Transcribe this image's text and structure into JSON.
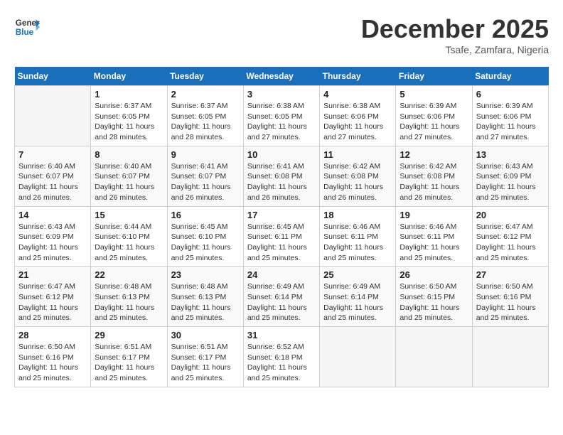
{
  "header": {
    "logo_line1": "General",
    "logo_line2": "Blue",
    "month": "December 2025",
    "location": "Tsafe, Zamfara, Nigeria"
  },
  "days_of_week": [
    "Sunday",
    "Monday",
    "Tuesday",
    "Wednesday",
    "Thursday",
    "Friday",
    "Saturday"
  ],
  "weeks": [
    [
      {
        "day": "",
        "empty": true
      },
      {
        "day": "1",
        "sunrise": "6:37 AM",
        "sunset": "6:05 PM",
        "daylight": "11 hours and 28 minutes."
      },
      {
        "day": "2",
        "sunrise": "6:37 AM",
        "sunset": "6:05 PM",
        "daylight": "11 hours and 28 minutes."
      },
      {
        "day": "3",
        "sunrise": "6:38 AM",
        "sunset": "6:05 PM",
        "daylight": "11 hours and 27 minutes."
      },
      {
        "day": "4",
        "sunrise": "6:38 AM",
        "sunset": "6:06 PM",
        "daylight": "11 hours and 27 minutes."
      },
      {
        "day": "5",
        "sunrise": "6:39 AM",
        "sunset": "6:06 PM",
        "daylight": "11 hours and 27 minutes."
      },
      {
        "day": "6",
        "sunrise": "6:39 AM",
        "sunset": "6:06 PM",
        "daylight": "11 hours and 27 minutes."
      }
    ],
    [
      {
        "day": "7",
        "sunrise": "6:40 AM",
        "sunset": "6:07 PM",
        "daylight": "11 hours and 26 minutes."
      },
      {
        "day": "8",
        "sunrise": "6:40 AM",
        "sunset": "6:07 PM",
        "daylight": "11 hours and 26 minutes."
      },
      {
        "day": "9",
        "sunrise": "6:41 AM",
        "sunset": "6:07 PM",
        "daylight": "11 hours and 26 minutes."
      },
      {
        "day": "10",
        "sunrise": "6:41 AM",
        "sunset": "6:08 PM",
        "daylight": "11 hours and 26 minutes."
      },
      {
        "day": "11",
        "sunrise": "6:42 AM",
        "sunset": "6:08 PM",
        "daylight": "11 hours and 26 minutes."
      },
      {
        "day": "12",
        "sunrise": "6:42 AM",
        "sunset": "6:08 PM",
        "daylight": "11 hours and 26 minutes."
      },
      {
        "day": "13",
        "sunrise": "6:43 AM",
        "sunset": "6:09 PM",
        "daylight": "11 hours and 25 minutes."
      }
    ],
    [
      {
        "day": "14",
        "sunrise": "6:43 AM",
        "sunset": "6:09 PM",
        "daylight": "11 hours and 25 minutes."
      },
      {
        "day": "15",
        "sunrise": "6:44 AM",
        "sunset": "6:10 PM",
        "daylight": "11 hours and 25 minutes."
      },
      {
        "day": "16",
        "sunrise": "6:45 AM",
        "sunset": "6:10 PM",
        "daylight": "11 hours and 25 minutes."
      },
      {
        "day": "17",
        "sunrise": "6:45 AM",
        "sunset": "6:11 PM",
        "daylight": "11 hours and 25 minutes."
      },
      {
        "day": "18",
        "sunrise": "6:46 AM",
        "sunset": "6:11 PM",
        "daylight": "11 hours and 25 minutes."
      },
      {
        "day": "19",
        "sunrise": "6:46 AM",
        "sunset": "6:11 PM",
        "daylight": "11 hours and 25 minutes."
      },
      {
        "day": "20",
        "sunrise": "6:47 AM",
        "sunset": "6:12 PM",
        "daylight": "11 hours and 25 minutes."
      }
    ],
    [
      {
        "day": "21",
        "sunrise": "6:47 AM",
        "sunset": "6:12 PM",
        "daylight": "11 hours and 25 minutes."
      },
      {
        "day": "22",
        "sunrise": "6:48 AM",
        "sunset": "6:13 PM",
        "daylight": "11 hours and 25 minutes."
      },
      {
        "day": "23",
        "sunrise": "6:48 AM",
        "sunset": "6:13 PM",
        "daylight": "11 hours and 25 minutes."
      },
      {
        "day": "24",
        "sunrise": "6:49 AM",
        "sunset": "6:14 PM",
        "daylight": "11 hours and 25 minutes."
      },
      {
        "day": "25",
        "sunrise": "6:49 AM",
        "sunset": "6:14 PM",
        "daylight": "11 hours and 25 minutes."
      },
      {
        "day": "26",
        "sunrise": "6:50 AM",
        "sunset": "6:15 PM",
        "daylight": "11 hours and 25 minutes."
      },
      {
        "day": "27",
        "sunrise": "6:50 AM",
        "sunset": "6:16 PM",
        "daylight": "11 hours and 25 minutes."
      }
    ],
    [
      {
        "day": "28",
        "sunrise": "6:50 AM",
        "sunset": "6:16 PM",
        "daylight": "11 hours and 25 minutes."
      },
      {
        "day": "29",
        "sunrise": "6:51 AM",
        "sunset": "6:17 PM",
        "daylight": "11 hours and 25 minutes."
      },
      {
        "day": "30",
        "sunrise": "6:51 AM",
        "sunset": "6:17 PM",
        "daylight": "11 hours and 25 minutes."
      },
      {
        "day": "31",
        "sunrise": "6:52 AM",
        "sunset": "6:18 PM",
        "daylight": "11 hours and 25 minutes."
      },
      {
        "day": "",
        "empty": true
      },
      {
        "day": "",
        "empty": true
      },
      {
        "day": "",
        "empty": true
      }
    ]
  ],
  "labels": {
    "sunrise": "Sunrise:",
    "sunset": "Sunset:",
    "daylight": "Daylight:"
  }
}
